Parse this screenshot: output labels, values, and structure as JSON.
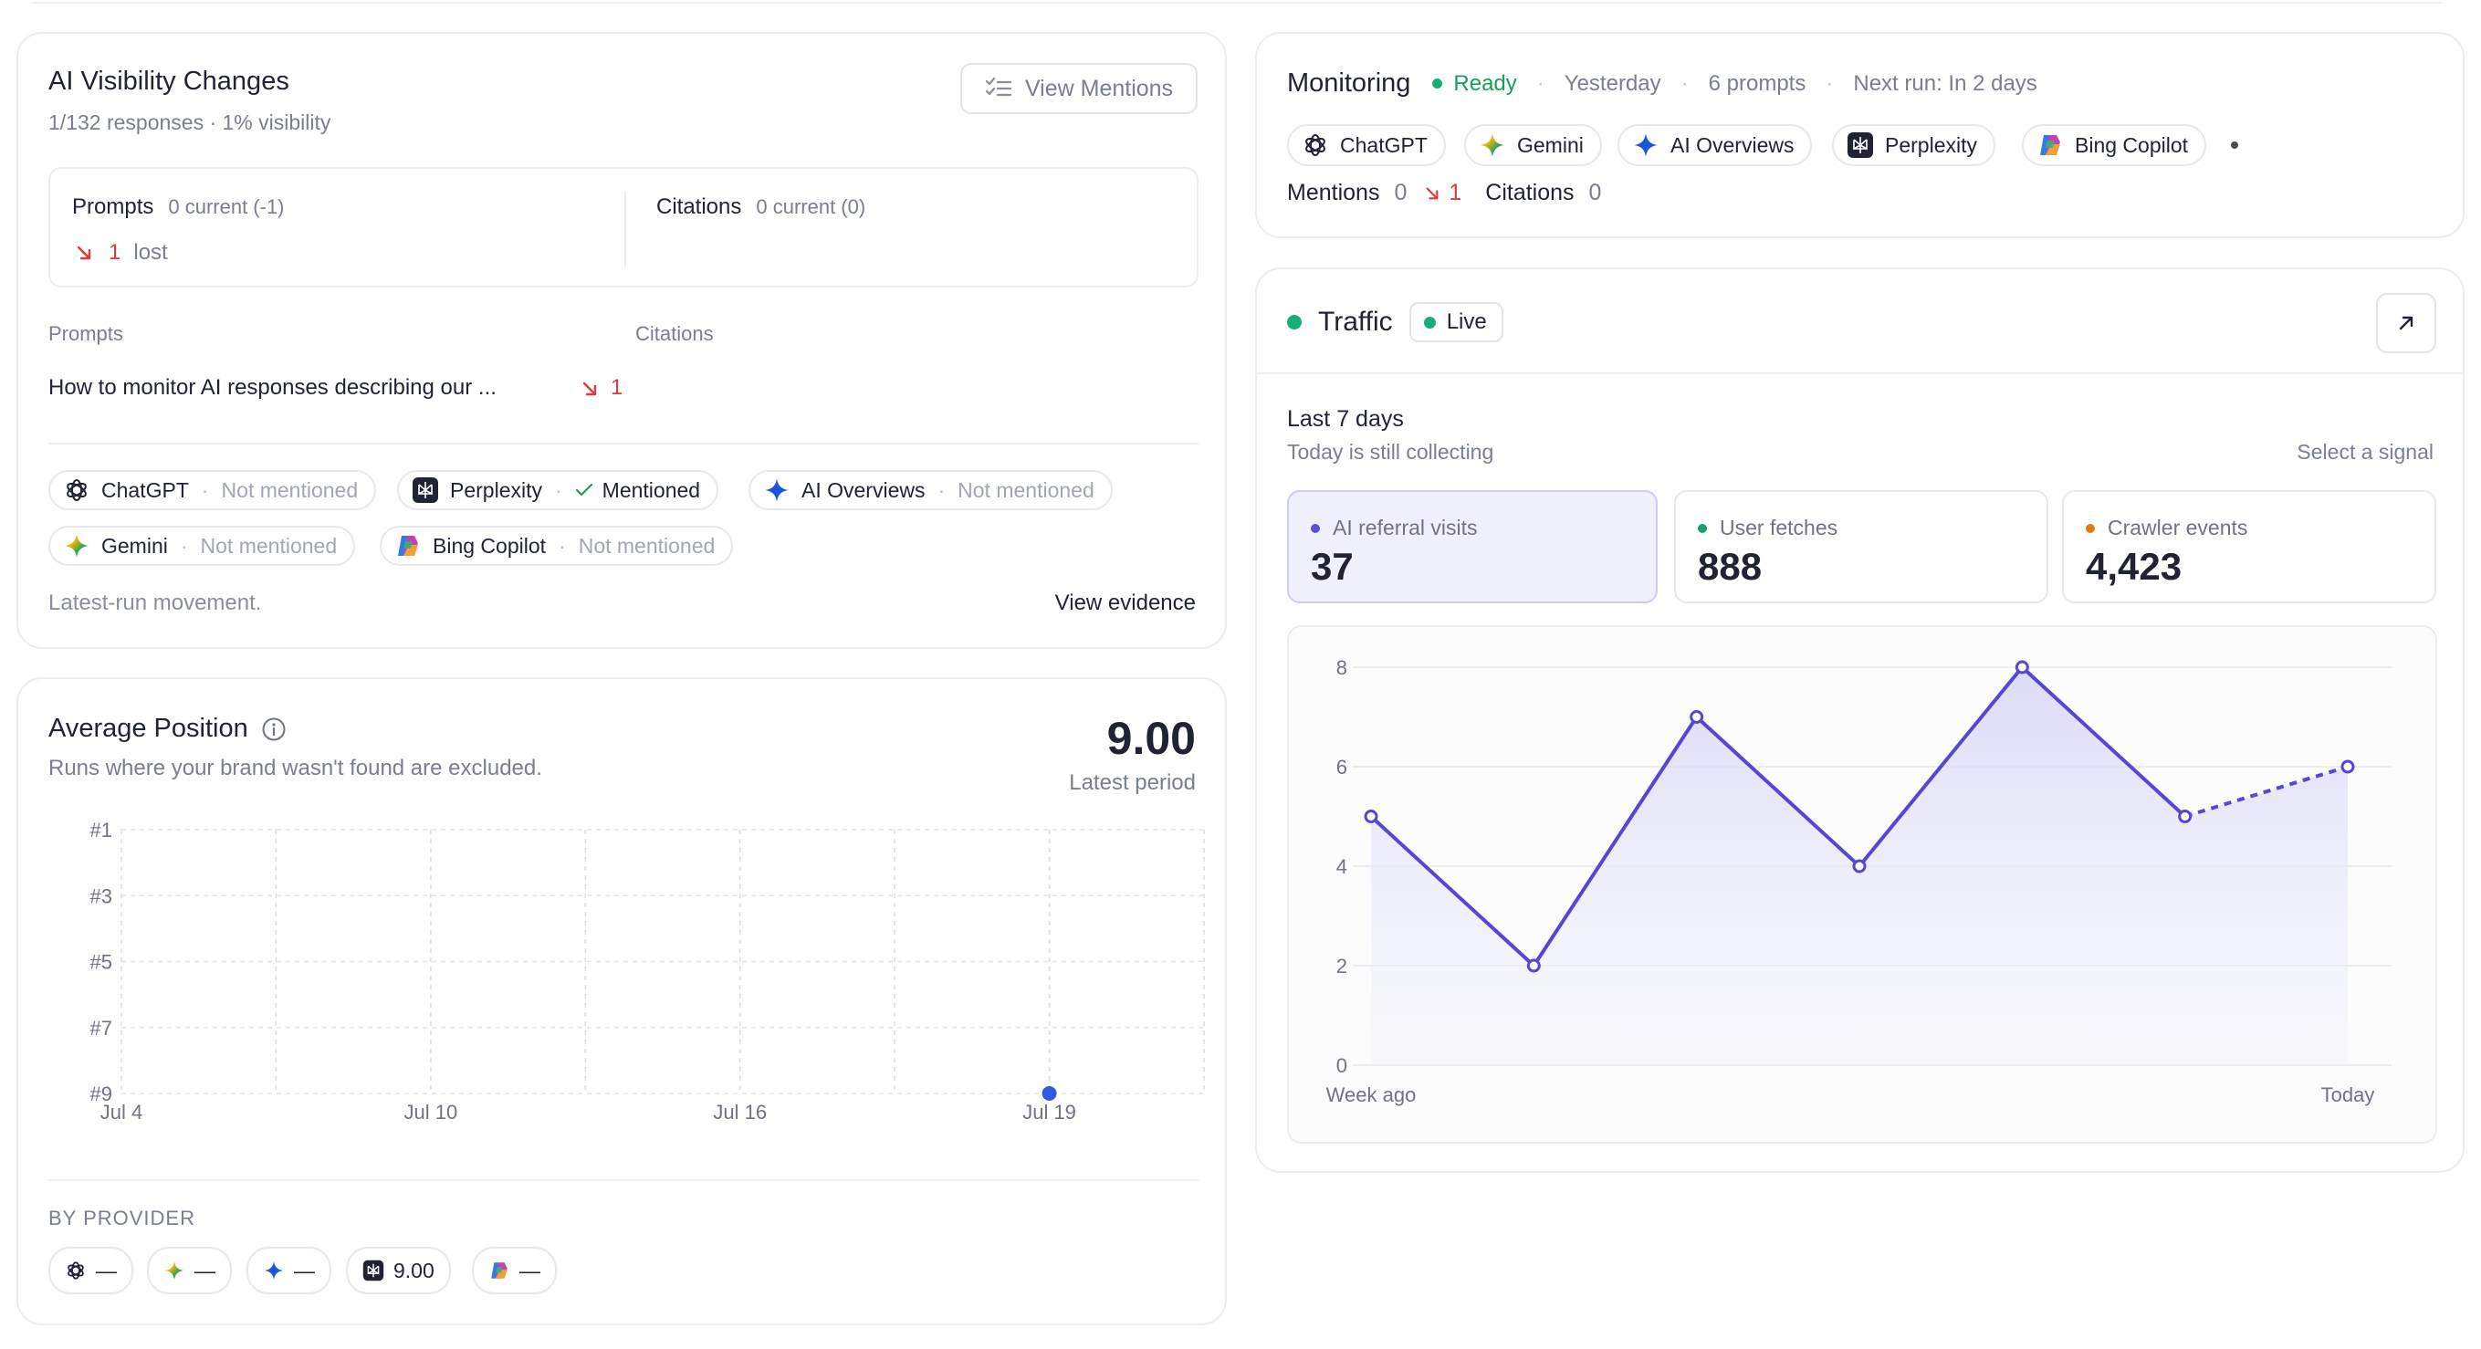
{
  "visibility": {
    "title": "AI Visibility Changes",
    "subtitle": "1/132 responses · 1% visibility",
    "view_mentions": "View Mentions",
    "summary": {
      "prompts_label": "Prompts",
      "prompts_meta": "0 current (-1)",
      "lost_count": "1",
      "lost_label": "lost",
      "citations_label": "Citations",
      "citations_meta": "0 current (0)"
    },
    "table": {
      "col_prompts": "Prompts",
      "col_citations": "Citations",
      "rows": [
        {
          "prompt": "How to monitor AI responses describing our ...",
          "change": "1"
        }
      ]
    },
    "providers": [
      {
        "name": "ChatGPT",
        "status": "Not mentioned",
        "icon": "chatgpt-icon"
      },
      {
        "name": "Perplexity",
        "status": "Mentioned",
        "icon": "perplexity-icon"
      },
      {
        "name": "AI Overviews",
        "status": "Not mentioned",
        "icon": "ai-overviews-icon"
      },
      {
        "name": "Gemini",
        "status": "Not mentioned",
        "icon": "gemini-icon"
      },
      {
        "name": "Bing Copilot",
        "status": "Not mentioned",
        "icon": "bing-copilot-icon"
      }
    ],
    "footnote": "Latest-run movement.",
    "view_evidence": "View evidence"
  },
  "position": {
    "title": "Average Position",
    "subtitle": "Runs where your brand wasn't found are excluded.",
    "value": "9.00",
    "value_label": "Latest period",
    "by_provider_label": "BY PROVIDER",
    "provider_values": [
      {
        "icon": "chatgpt-icon",
        "value": "—"
      },
      {
        "icon": "gemini-icon",
        "value": "—"
      },
      {
        "icon": "ai-overviews-icon",
        "value": "—"
      },
      {
        "icon": "perplexity-icon",
        "value": "9.00"
      },
      {
        "icon": "bing-copilot-icon",
        "value": "—"
      }
    ]
  },
  "monitoring": {
    "title": "Monitoring",
    "status": "Ready",
    "last_run": "Yesterday",
    "prompts": "6 prompts",
    "next_run": "Next run: In 2 days",
    "engines": [
      "ChatGPT",
      "Gemini",
      "AI Overviews",
      "Perplexity",
      "Bing Copilot"
    ],
    "mentions_label": "Mentions",
    "mentions_value": "0",
    "mentions_change": "1",
    "citations_label": "Citations",
    "citations_value": "0"
  },
  "traffic": {
    "title": "Traffic",
    "live_label": "Live",
    "period": "Last 7 days",
    "period_note": "Today is still collecting",
    "select_signal": "Select a signal",
    "signals": [
      {
        "label": "AI referral visits",
        "value": "37",
        "color": "#5a4fd6",
        "selected": true
      },
      {
        "label": "User fetches",
        "value": "888",
        "color": "#15a36b",
        "selected": false
      },
      {
        "label": "Crawler events",
        "value": "4,423",
        "color": "#e07a13",
        "selected": false
      }
    ]
  },
  "colors": {
    "accent": "#5546d6",
    "green": "#16b076",
    "red": "#dc3b3b",
    "position_point": "#2f5be0"
  },
  "chart_data": [
    {
      "type": "scatter",
      "title": "Average Position",
      "x": [
        "Jul 19"
      ],
      "y": [
        9
      ],
      "x_ticks": [
        "Jul 4",
        "Jul 10",
        "Jul 16",
        "Jul 19"
      ],
      "y_ticks": [
        "#1",
        "#3",
        "#5",
        "#7",
        "#9"
      ],
      "y_inverted": true,
      "ylim": [
        1,
        9
      ],
      "grid": true
    },
    {
      "type": "area",
      "title": "AI referral visits",
      "categories": [
        "Week ago",
        "",
        "",
        "",
        "",
        "",
        "Today"
      ],
      "x_ticks": [
        "Week ago",
        "Today"
      ],
      "y_ticks": [
        0,
        2,
        4,
        6,
        8
      ],
      "series": [
        {
          "name": "AI referral visits",
          "values": [
            5,
            2,
            7,
            4,
            8,
            5,
            6
          ],
          "partial_last": true
        }
      ],
      "ylim": [
        0,
        8
      ],
      "grid": true
    }
  ]
}
